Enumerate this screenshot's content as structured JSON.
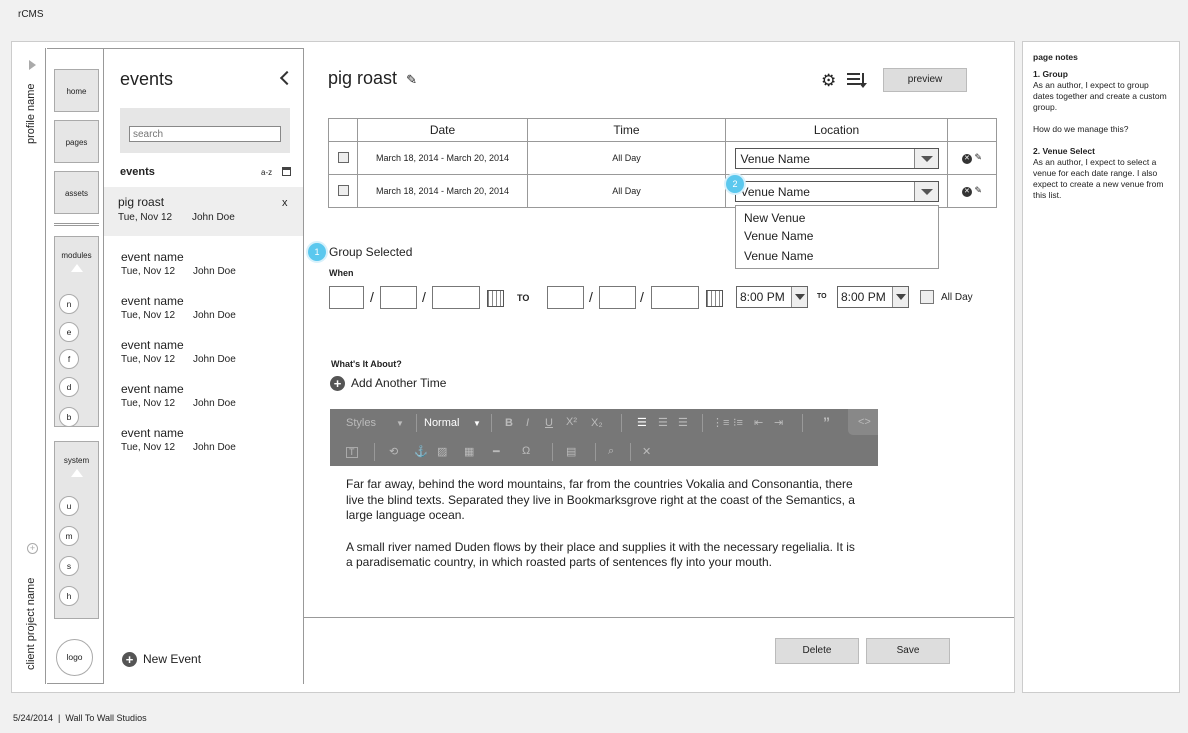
{
  "app": {
    "title": "rCMS"
  },
  "footer": {
    "text": "5/24/2014  |  Wall To Wall Studios"
  },
  "rail": {
    "profile": "profile name",
    "project": "client project name"
  },
  "nav": {
    "items": [
      "home",
      "pages",
      "assets"
    ],
    "modules_label": "modules",
    "modules": [
      "n",
      "e",
      "f",
      "d",
      "b"
    ],
    "system_label": "system",
    "system": [
      "u",
      "m",
      "s",
      "h"
    ],
    "logo": "logo"
  },
  "events": {
    "title": "events",
    "search_placeholder": "search",
    "list_header": "events",
    "sort_label": "a-z",
    "selected": {
      "name": "pig roast",
      "date": "Tue, Nov 12",
      "author": "John Doe",
      "close": "x"
    },
    "items": [
      {
        "name": "event name",
        "date": "Tue, Nov 12",
        "author": "John Doe"
      },
      {
        "name": "event name",
        "date": "Tue, Nov 12",
        "author": "John Doe"
      },
      {
        "name": "event name",
        "date": "Tue, Nov 12",
        "author": "John Doe"
      },
      {
        "name": "event name",
        "date": "Tue, Nov 12",
        "author": "John Doe"
      },
      {
        "name": "event name",
        "date": "Tue, Nov 12",
        "author": "John Doe"
      }
    ],
    "new_label": "New Event"
  },
  "main": {
    "title": "pig roast",
    "preview_label": "preview",
    "table": {
      "headers": [
        "Date",
        "Time",
        "Location"
      ],
      "rows": [
        {
          "date": "March 18, 2014  -  March 20, 2014",
          "time": "All Day",
          "venue": "Venue Name"
        },
        {
          "date": "March 18, 2014  -  March 20, 2014",
          "time": "All Day",
          "venue": "Venue Name"
        }
      ]
    },
    "venue_options": [
      "New Venue",
      "Venue Name",
      "Venue Name"
    ],
    "badges": [
      "1",
      "2"
    ],
    "group_label": "Group Selected",
    "when_label": "When",
    "to_label": "TO",
    "to_small": "TO",
    "start_time": "8:00 PM",
    "end_time": "8:00 PM",
    "allday_label": "All Day",
    "about_label": "What's It About?",
    "add_time_label": "Add Another Time",
    "toolbar": {
      "styles": "Styles",
      "format": "Normal"
    },
    "body_p1": "Far far away, behind the word mountains, far from the countries Vokalia and Consonantia, there live the blind texts. Separated they live in Bookmarksgrove right at the coast of the Semantics, a large language ocean.",
    "body_p2": "A small river named Duden flows by their place and supplies it with the necessary regelialia. It is a paradisematic country, in which roasted parts of sentences fly into your mouth.",
    "delete_label": "Delete",
    "save_label": "Save"
  },
  "notes": {
    "title": "page notes",
    "n1_title": "1. Group",
    "n1_text": "As an author, I expect to group dates together and create a custom group.",
    "n1_q": "How do we manage this?",
    "n2_title": "2. Venue Select",
    "n2_text": "As an author, I expect to select a venue for each date range. I also expect to create a new venue from this list."
  }
}
